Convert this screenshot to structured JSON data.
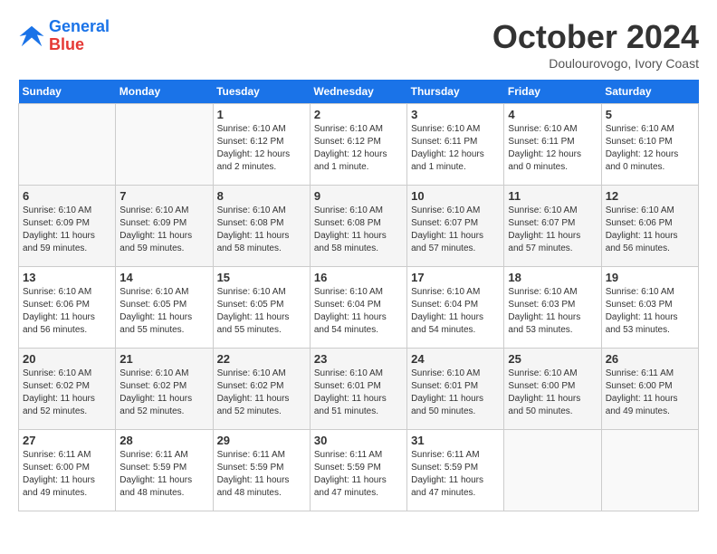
{
  "header": {
    "logo_line1": "General",
    "logo_line2": "Blue",
    "month": "October 2024",
    "location": "Doulourovogo, Ivory Coast"
  },
  "weekdays": [
    "Sunday",
    "Monday",
    "Tuesday",
    "Wednesday",
    "Thursday",
    "Friday",
    "Saturday"
  ],
  "weeks": [
    [
      {
        "day": "",
        "info": ""
      },
      {
        "day": "",
        "info": ""
      },
      {
        "day": "1",
        "info": "Sunrise: 6:10 AM\nSunset: 6:12 PM\nDaylight: 12 hours\nand 2 minutes."
      },
      {
        "day": "2",
        "info": "Sunrise: 6:10 AM\nSunset: 6:12 PM\nDaylight: 12 hours\nand 1 minute."
      },
      {
        "day": "3",
        "info": "Sunrise: 6:10 AM\nSunset: 6:11 PM\nDaylight: 12 hours\nand 1 minute."
      },
      {
        "day": "4",
        "info": "Sunrise: 6:10 AM\nSunset: 6:11 PM\nDaylight: 12 hours\nand 0 minutes."
      },
      {
        "day": "5",
        "info": "Sunrise: 6:10 AM\nSunset: 6:10 PM\nDaylight: 12 hours\nand 0 minutes."
      }
    ],
    [
      {
        "day": "6",
        "info": "Sunrise: 6:10 AM\nSunset: 6:09 PM\nDaylight: 11 hours\nand 59 minutes."
      },
      {
        "day": "7",
        "info": "Sunrise: 6:10 AM\nSunset: 6:09 PM\nDaylight: 11 hours\nand 59 minutes."
      },
      {
        "day": "8",
        "info": "Sunrise: 6:10 AM\nSunset: 6:08 PM\nDaylight: 11 hours\nand 58 minutes."
      },
      {
        "day": "9",
        "info": "Sunrise: 6:10 AM\nSunset: 6:08 PM\nDaylight: 11 hours\nand 58 minutes."
      },
      {
        "day": "10",
        "info": "Sunrise: 6:10 AM\nSunset: 6:07 PM\nDaylight: 11 hours\nand 57 minutes."
      },
      {
        "day": "11",
        "info": "Sunrise: 6:10 AM\nSunset: 6:07 PM\nDaylight: 11 hours\nand 57 minutes."
      },
      {
        "day": "12",
        "info": "Sunrise: 6:10 AM\nSunset: 6:06 PM\nDaylight: 11 hours\nand 56 minutes."
      }
    ],
    [
      {
        "day": "13",
        "info": "Sunrise: 6:10 AM\nSunset: 6:06 PM\nDaylight: 11 hours\nand 56 minutes."
      },
      {
        "day": "14",
        "info": "Sunrise: 6:10 AM\nSunset: 6:05 PM\nDaylight: 11 hours\nand 55 minutes."
      },
      {
        "day": "15",
        "info": "Sunrise: 6:10 AM\nSunset: 6:05 PM\nDaylight: 11 hours\nand 55 minutes."
      },
      {
        "day": "16",
        "info": "Sunrise: 6:10 AM\nSunset: 6:04 PM\nDaylight: 11 hours\nand 54 minutes."
      },
      {
        "day": "17",
        "info": "Sunrise: 6:10 AM\nSunset: 6:04 PM\nDaylight: 11 hours\nand 54 minutes."
      },
      {
        "day": "18",
        "info": "Sunrise: 6:10 AM\nSunset: 6:03 PM\nDaylight: 11 hours\nand 53 minutes."
      },
      {
        "day": "19",
        "info": "Sunrise: 6:10 AM\nSunset: 6:03 PM\nDaylight: 11 hours\nand 53 minutes."
      }
    ],
    [
      {
        "day": "20",
        "info": "Sunrise: 6:10 AM\nSunset: 6:02 PM\nDaylight: 11 hours\nand 52 minutes."
      },
      {
        "day": "21",
        "info": "Sunrise: 6:10 AM\nSunset: 6:02 PM\nDaylight: 11 hours\nand 52 minutes."
      },
      {
        "day": "22",
        "info": "Sunrise: 6:10 AM\nSunset: 6:02 PM\nDaylight: 11 hours\nand 52 minutes."
      },
      {
        "day": "23",
        "info": "Sunrise: 6:10 AM\nSunset: 6:01 PM\nDaylight: 11 hours\nand 51 minutes."
      },
      {
        "day": "24",
        "info": "Sunrise: 6:10 AM\nSunset: 6:01 PM\nDaylight: 11 hours\nand 50 minutes."
      },
      {
        "day": "25",
        "info": "Sunrise: 6:10 AM\nSunset: 6:00 PM\nDaylight: 11 hours\nand 50 minutes."
      },
      {
        "day": "26",
        "info": "Sunrise: 6:11 AM\nSunset: 6:00 PM\nDaylight: 11 hours\nand 49 minutes."
      }
    ],
    [
      {
        "day": "27",
        "info": "Sunrise: 6:11 AM\nSunset: 6:00 PM\nDaylight: 11 hours\nand 49 minutes."
      },
      {
        "day": "28",
        "info": "Sunrise: 6:11 AM\nSunset: 5:59 PM\nDaylight: 11 hours\nand 48 minutes."
      },
      {
        "day": "29",
        "info": "Sunrise: 6:11 AM\nSunset: 5:59 PM\nDaylight: 11 hours\nand 48 minutes."
      },
      {
        "day": "30",
        "info": "Sunrise: 6:11 AM\nSunset: 5:59 PM\nDaylight: 11 hours\nand 47 minutes."
      },
      {
        "day": "31",
        "info": "Sunrise: 6:11 AM\nSunset: 5:59 PM\nDaylight: 11 hours\nand 47 minutes."
      },
      {
        "day": "",
        "info": ""
      },
      {
        "day": "",
        "info": ""
      }
    ]
  ]
}
